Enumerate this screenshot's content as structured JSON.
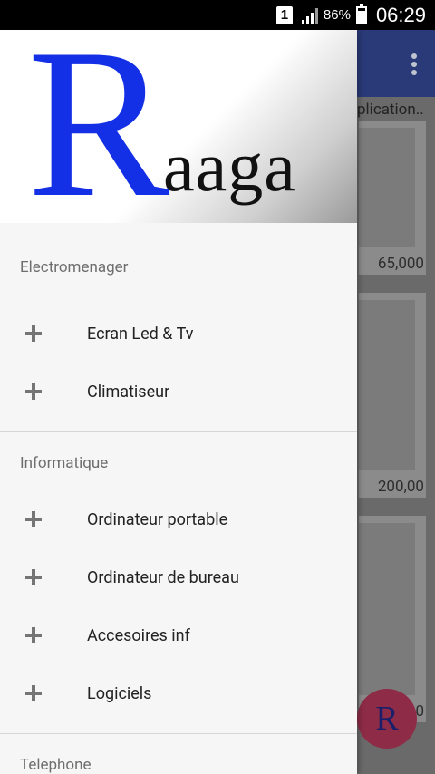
{
  "status_bar": {
    "sim": "1",
    "battery_percent": "86%",
    "time": "06:29"
  },
  "background_app": {
    "subtitle": "plication..",
    "prices": [
      "65,000",
      "200,00",
      "0"
    ],
    "fab_letter": "R",
    "toolbar_color": "#2a3a78"
  },
  "drawer": {
    "logo": {
      "big_letter": "R",
      "rest": "aaga"
    },
    "sections": [
      {
        "title": "Electromenager",
        "items": [
          {
            "label": "Ecran Led & Tv"
          },
          {
            "label": "Climatiseur"
          }
        ]
      },
      {
        "title": "Informatique",
        "items": [
          {
            "label": "Ordinateur portable"
          },
          {
            "label": "Ordinateur de bureau"
          },
          {
            "label": "Accesoires inf"
          },
          {
            "label": "Logiciels"
          }
        ]
      },
      {
        "title": "Telephone",
        "items": []
      }
    ]
  }
}
